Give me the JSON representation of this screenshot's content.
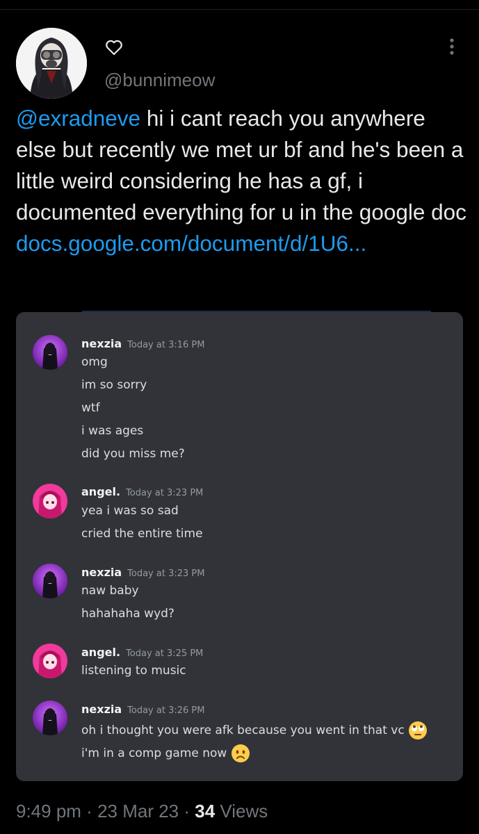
{
  "tweet": {
    "handle": "@bunnimeow",
    "mention": "@exradneve",
    "body": " hi i cant reach you anywhere else but recently we met ur bf and he's been a little weird considering he has a gf, i documented everything for u in the google doc ",
    "link": "docs.google.com/document/d/1U6..."
  },
  "messages": [
    {
      "user": "nexzia",
      "time": "Today at 3:16 PM",
      "lines": [
        "omg",
        "im so sorry",
        "wtf",
        "i was ages",
        "did you miss me?"
      ]
    },
    {
      "user": "angel.",
      "time": "Today at 3:23 PM",
      "lines": [
        "yea i was so sad",
        "cried the entire time"
      ]
    },
    {
      "user": "nexzia",
      "time": "Today at 3:23 PM",
      "lines": [
        "naw baby",
        "hahahaha wyd?"
      ]
    },
    {
      "user": "angel.",
      "time": "Today at 3:25 PM",
      "lines": [
        "listening to music"
      ]
    },
    {
      "user": "nexzia",
      "time": "Today at 3:26 PM",
      "lines": [
        "oh i thought you were afk because you went in that vc",
        "i'm in a comp game now"
      ]
    }
  ],
  "footer": {
    "time": "9:49 pm",
    "sep1": " · ",
    "date": "23 Mar 23",
    "sep2": " · ",
    "views_count": "34",
    "views_label": " Views"
  },
  "icons": {
    "heart": "heart-outline-icon",
    "more": "more-vertical-icon",
    "rolling_eyes": "rolling-eyes-emoji",
    "frowning": "frowning-emoji"
  },
  "colors": {
    "background": "#000000",
    "link": "#1d9bf0",
    "secondary_text": "#71767b",
    "discord_bg": "#313338"
  }
}
